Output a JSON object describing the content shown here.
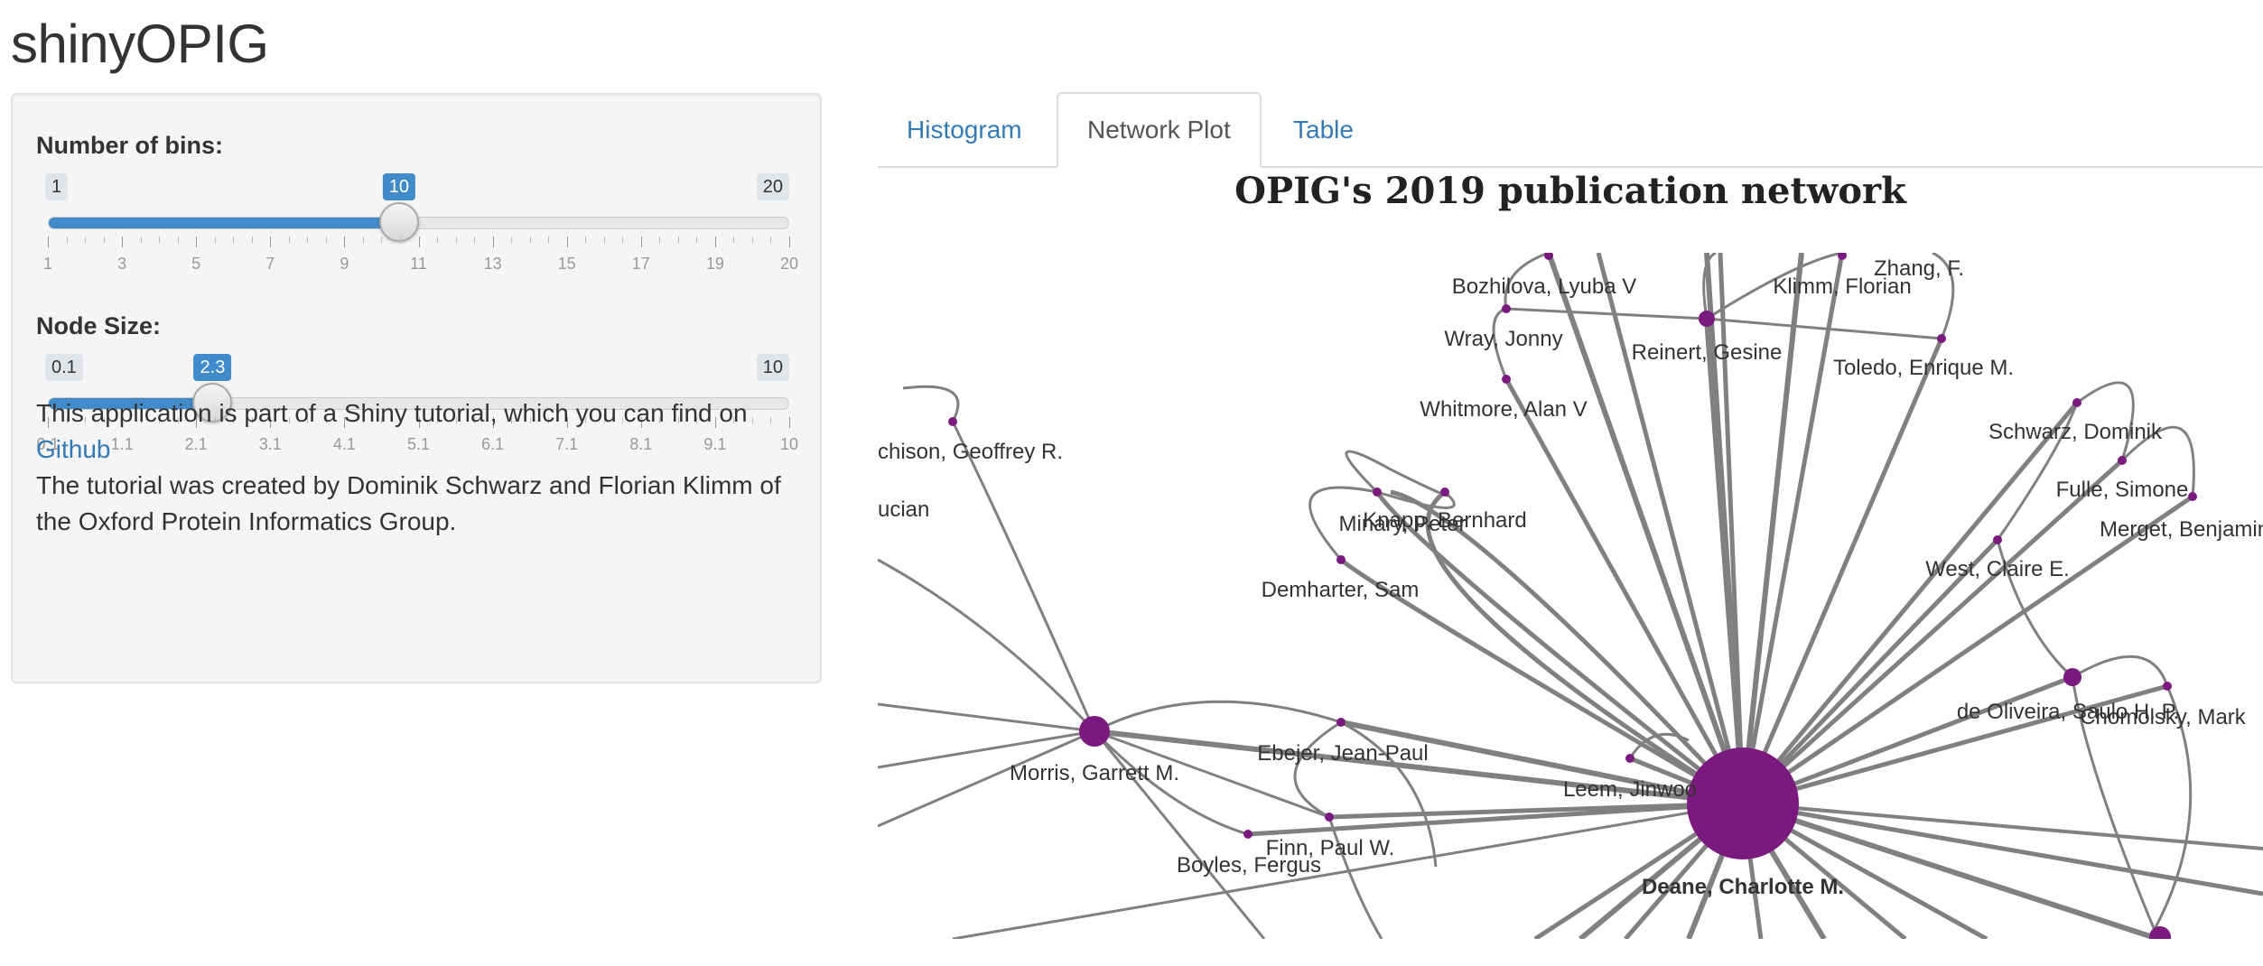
{
  "app": {
    "title": "shinyOPIG"
  },
  "sidebar": {
    "bins": {
      "label": "Number of bins:",
      "min": 1,
      "max": 20,
      "value": 10,
      "min_label": "1",
      "max_label": "20",
      "value_label": "10",
      "tick_labels": [
        "1",
        "3",
        "5",
        "7",
        "9",
        "11",
        "13",
        "15",
        "17",
        "19",
        "20"
      ]
    },
    "node_size": {
      "label": "Node Size:",
      "min": 0.1,
      "max": 10,
      "value": 2.3,
      "min_label": "0.1",
      "max_label": "10",
      "value_label": "2.3",
      "tick_labels": [
        "0.1",
        "1.1",
        "2.1",
        "3.1",
        "4.1",
        "5.1",
        "6.1",
        "7.1",
        "8.1",
        "9.1",
        "10"
      ]
    },
    "about": {
      "line1": "This application is part of a Shiny tutorial, which you can find on",
      "link": "Github",
      "line2": "The tutorial was created by Dominik Schwarz and Florian Klimm of the Oxford Protein Informatics Group."
    }
  },
  "tabs": [
    {
      "label": "Histogram",
      "active": false
    },
    {
      "label": "Network Plot",
      "active": true
    },
    {
      "label": "Table",
      "active": false
    }
  ],
  "plot": {
    "title": "OPIG's 2019 publication network",
    "node_color": "#7a1a7f",
    "edge_color": "#808080",
    "labels": {
      "bozhilova": "Bozhilova, Lyuba V",
      "zhang": "Zhang, F.",
      "klimm": "Klimm, Florian",
      "wray": "Wray, Jonny",
      "reinert": "Reinert, Gesine",
      "toledo": "Toledo, Enrique M.",
      "whitmore": "Whitmore, Alan V",
      "hutchison": "chison, Geoffrey R.",
      "lucian": "ucian",
      "schwarz": "Schwarz, Dominik",
      "fulle": "Fulle, Simone",
      "merget": "Merget, Benjamin",
      "minary": "Minary, Peter",
      "knapp": "Knapp, Bernhard",
      "demharter": "Demharter, Sam",
      "west": "West, Claire E.",
      "deoliveira": "de Oliveira, Saulo H. P.",
      "chomsky": "Chomolsky, Mark",
      "morris": "Morris, Garrett M.",
      "ebejer": "Ebejer, Jean-Paul",
      "leem": "Leem, Jinwoo",
      "finn": "Finn, Paul W.",
      "boyles": "Boyles, Fergus",
      "deane": "Deane, Charlotte M."
    }
  }
}
